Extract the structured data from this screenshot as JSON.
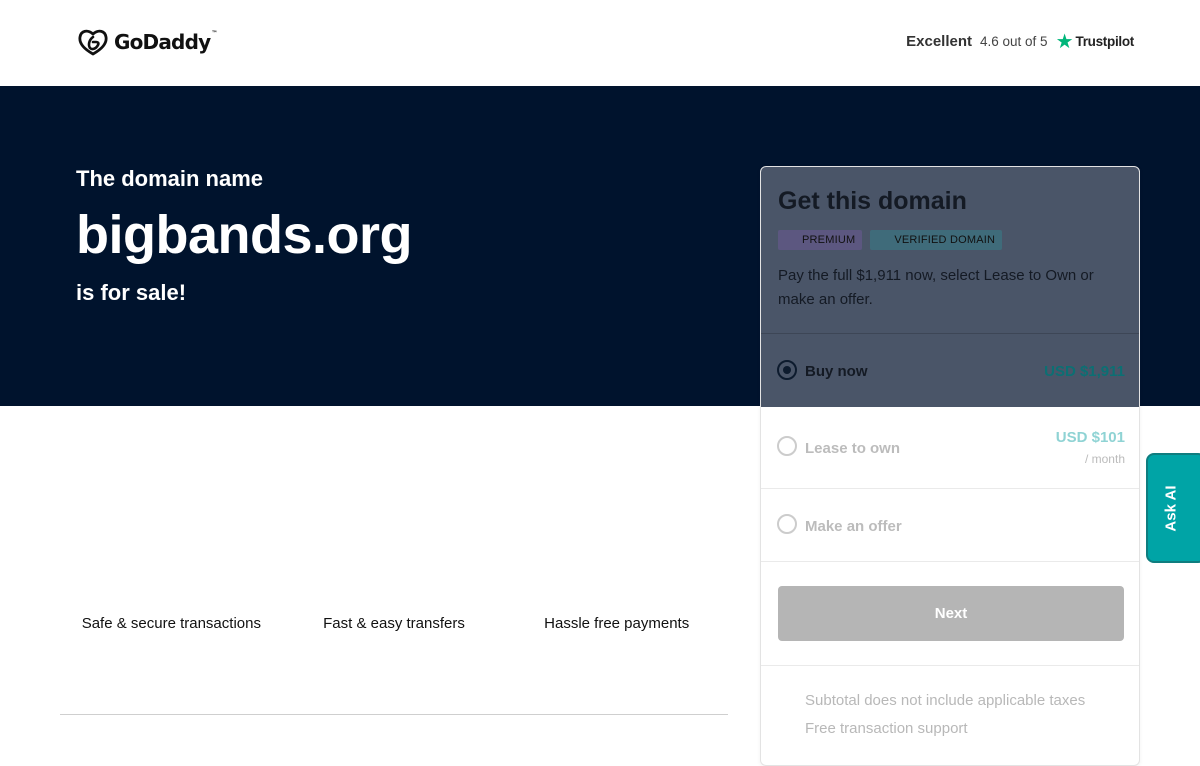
{
  "header": {
    "brand": "GoDaddy",
    "brand_tm": "™",
    "logo_icon": "godaddy-logo-icon",
    "trust_rating_word": "Excellent",
    "trust_score": "4.6 out of 5",
    "trust_star": "★",
    "trust_brand": "Trustpilot"
  },
  "hero": {
    "pre_title": "The domain name",
    "domain": "bigbands.org",
    "post_title": "is for sale!"
  },
  "features": [
    {
      "label": "Safe & secure transactions"
    },
    {
      "label": "Fast & easy transfers"
    },
    {
      "label": "Hassle free payments"
    }
  ],
  "card": {
    "title": "Get this domain",
    "badges": [
      "PREMIUM",
      "VERIFIED DOMAIN"
    ],
    "description": "Pay the full $1,911 now, select Lease to Own or make an offer.",
    "options": [
      {
        "label": "Buy now",
        "price": "USD $1,911",
        "selected": true
      },
      {
        "label": "Lease to own",
        "price": "USD $101",
        "sub": "/ month",
        "selected": false
      },
      {
        "label": "Make an offer",
        "selected": false
      }
    ],
    "next_label": "Next",
    "notes": [
      "Subtotal does not include applicable taxes",
      "Free transaction support"
    ]
  },
  "ask_ai": {
    "label": "Ask AI"
  },
  "colors": {
    "hero_bg": "#00132d",
    "accent_teal": "#00a4a6",
    "trustpilot_green": "#00b67a",
    "price_teal": "#00a4a6"
  }
}
